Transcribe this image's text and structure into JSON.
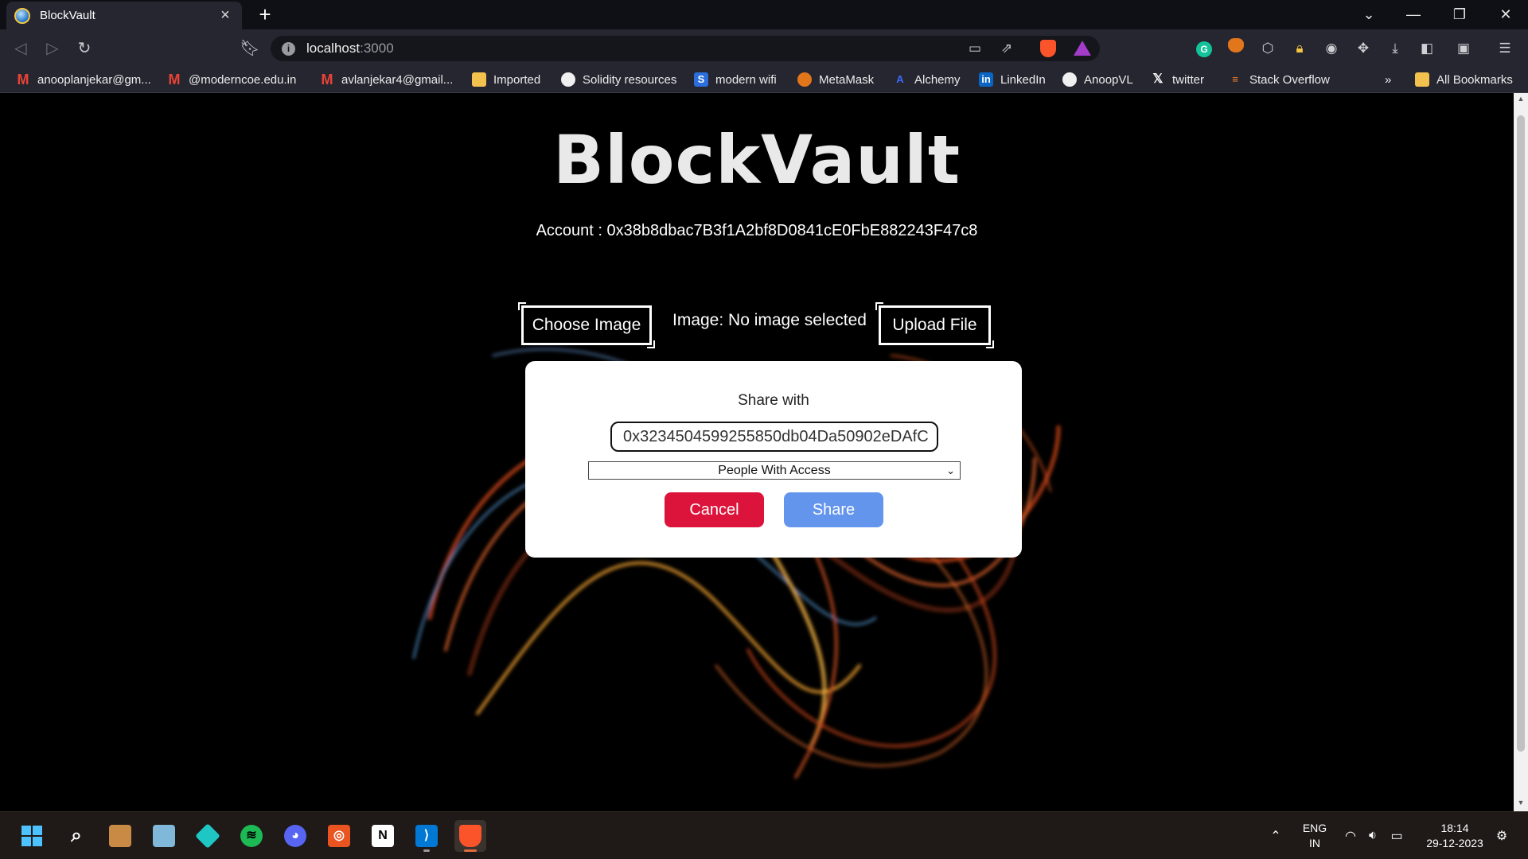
{
  "browser": {
    "tab_title": "BlockVault",
    "close_tab_glyph": "×",
    "new_tab_glyph": "+",
    "window_controls": [
      "⌄",
      "—",
      "❐",
      "✕"
    ],
    "url_host": "localhost",
    "url_port": ":3000",
    "bookmarks": [
      {
        "label": "anooplanjekar@gm...",
        "icon": "gmail-icon"
      },
      {
        "label": "@moderncoe.edu.in",
        "icon": "gmail-icon"
      },
      {
        "label": "avlanjekar4@gmail...",
        "icon": "gmail-icon"
      },
      {
        "label": "Imported",
        "icon": "folder-icon"
      },
      {
        "label": "Solidity resources",
        "icon": "github-icon"
      },
      {
        "label": "modern wifi",
        "icon": "s-icon"
      },
      {
        "label": "MetaMask",
        "icon": "metamask-icon"
      },
      {
        "label": "Alchemy",
        "icon": "alchemy-icon"
      },
      {
        "label": "LinkedIn",
        "icon": "linkedin-icon"
      },
      {
        "label": "AnoopVL",
        "icon": "github-icon"
      },
      {
        "label": "twitter",
        "icon": "x-icon"
      },
      {
        "label": "Stack Overflow",
        "icon": "stackoverflow-icon"
      }
    ],
    "more_bookmarks": "»",
    "all_bookmarks": "All Bookmarks"
  },
  "app": {
    "title": "BlockVault",
    "account_label": "Account : 0x38b8dbac7B3f1A2bf8D0841cE0FbE882243F47c8",
    "choose_image": "Choose Image",
    "image_status": "Image: No image selected",
    "upload_file": "Upload File"
  },
  "modal": {
    "label": "Share with",
    "address_value": "0x3234504599255850db04Da50902eDAfC",
    "select_value": "People With Access",
    "cancel": "Cancel",
    "share": "Share"
  },
  "taskbar": {
    "lang_top": "ENG",
    "lang_bottom": "IN",
    "time": "18:14",
    "date": "29-12-2023"
  },
  "colors": {
    "cancel": "#dc143c",
    "share": "#6495ed",
    "brave": "#fb542b"
  }
}
